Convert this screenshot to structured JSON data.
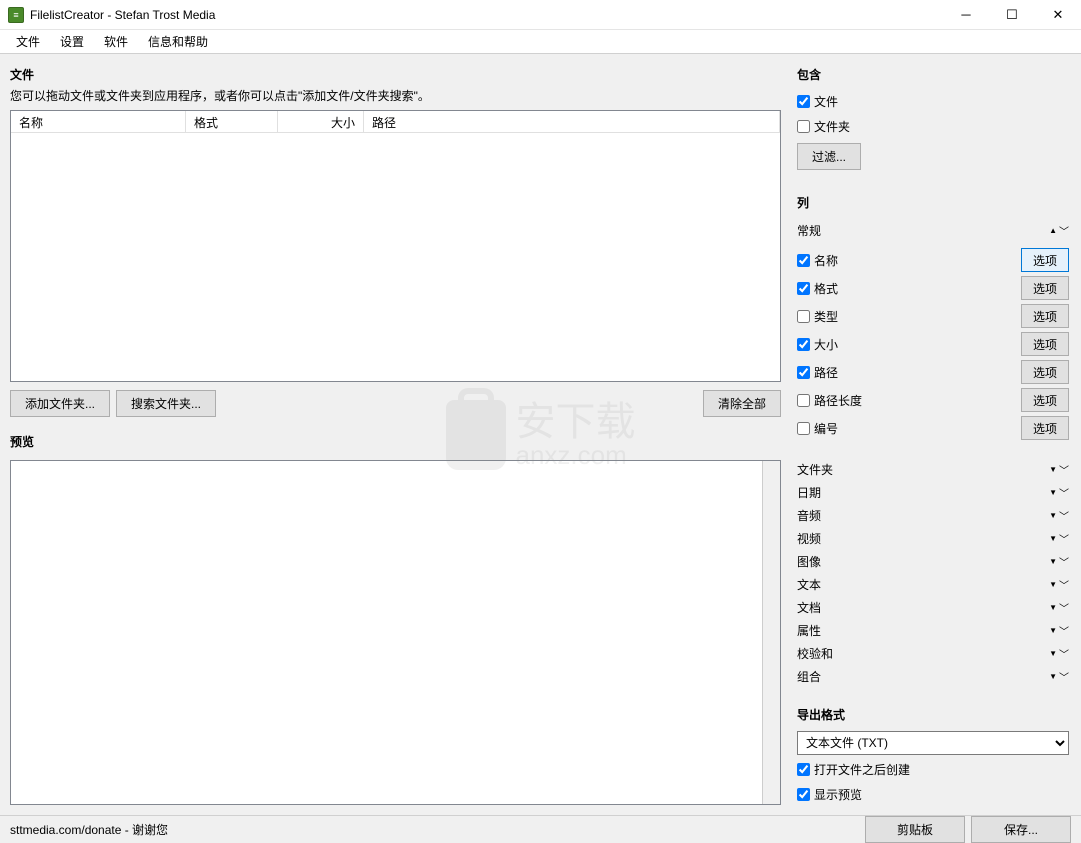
{
  "window": {
    "title": "FilelistCreator - Stefan Trost Media"
  },
  "menu": {
    "file": "文件",
    "settings": "设置",
    "software": "软件",
    "info_help": "信息和帮助"
  },
  "left": {
    "files_title": "文件",
    "hint": "您可以拖动文件或文件夹到应用程序，或者你可以点击\"添加文件/文件夹搜索\"。",
    "cols": {
      "name": "名称",
      "format": "格式",
      "size": "大小",
      "path": "路径"
    },
    "buttons": {
      "add_folder": "添加文件夹...",
      "search_folder": "搜索文件夹...",
      "clear_all": "清除全部"
    },
    "preview_title": "预览"
  },
  "right": {
    "include_title": "包含",
    "include_file": "文件",
    "include_folder": "文件夹",
    "filter_btn": "过滤...",
    "columns_title": "列",
    "general_group": "常规",
    "col_items": [
      {
        "label": "名称",
        "checked": true,
        "selected": true
      },
      {
        "label": "格式",
        "checked": true,
        "selected": false
      },
      {
        "label": "类型",
        "checked": false,
        "selected": false
      },
      {
        "label": "大小",
        "checked": true,
        "selected": false
      },
      {
        "label": "路径",
        "checked": true,
        "selected": false
      },
      {
        "label": "路径长度",
        "checked": false,
        "selected": false
      },
      {
        "label": "编号",
        "checked": false,
        "selected": false
      }
    ],
    "option_btn": "选项",
    "groups": [
      "文件夹",
      "日期",
      "音频",
      "视频",
      "图像",
      "文本",
      "文档",
      "属性",
      "校验和",
      "组合"
    ],
    "export_title": "导出格式",
    "export_value": "文本文件 (TXT)",
    "open_after": "打开文件之后创建",
    "show_preview": "显示预览"
  },
  "status": {
    "text": "sttmedia.com/donate - 谢谢您",
    "clipboard_btn": "剪贴板",
    "save_btn": "保存..."
  },
  "watermark": "安下载\nanxz.com"
}
